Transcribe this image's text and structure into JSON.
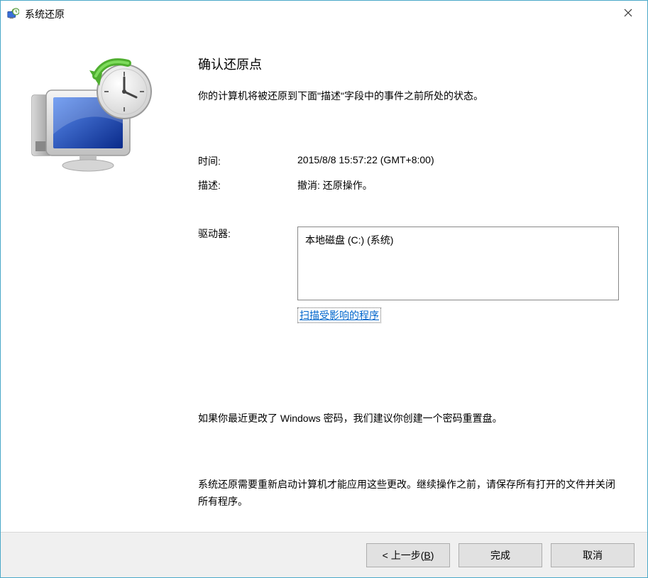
{
  "window": {
    "title": "系统还原"
  },
  "main": {
    "heading": "确认还原点",
    "intro": "你的计算机将被还原到下面\"描述\"字段中的事件之前所处的状态。",
    "time_label": "时间:",
    "time_value": "2015/8/8 15:57:22 (GMT+8:00)",
    "desc_label": "描述:",
    "desc_value": "撤消: 还原操作。",
    "drives_label": "驱动器:",
    "drives_value": "本地磁盘 (C:) (系统)",
    "scan_link": "扫描受影响的程序",
    "note1": "如果你最近更改了 Windows 密码，我们建议你创建一个密码重置盘。",
    "note2": "系统还原需要重新启动计算机才能应用这些更改。继续操作之前，请保存所有打开的文件并关闭所有程序。"
  },
  "footer": {
    "back_prefix": "< 上一步(",
    "back_key": "B",
    "back_suffix": ")",
    "finish": "完成",
    "cancel": "取消"
  }
}
